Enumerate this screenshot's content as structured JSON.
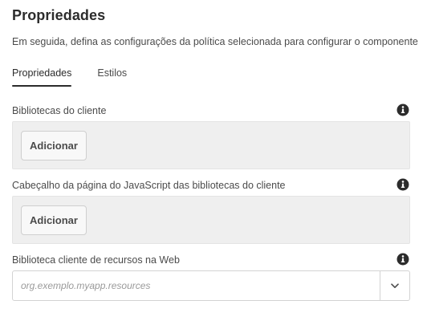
{
  "header": {
    "title": "Propriedades",
    "description": "Em seguida, defina as configurações da política selecionada para configurar o componente"
  },
  "tabs": [
    {
      "label": "Propriedades",
      "active": true
    },
    {
      "label": "Estilos",
      "active": false
    }
  ],
  "fields": {
    "client_libraries": {
      "label": "Bibliotecas do cliente",
      "add_label": "Adicionar",
      "icon": "info-icon"
    },
    "js_head_libraries": {
      "label": "Cabeçalho da página do JavaScript das bibliotecas do cliente",
      "add_label": "Adicionar",
      "icon": "info-icon"
    },
    "web_resources_library": {
      "label": "Biblioteca cliente de recursos na Web",
      "placeholder": "org.exemplo.myapp.resources",
      "value": "",
      "icon": "info-icon",
      "toggle_icon": "chevron-down-icon"
    }
  },
  "colors": {
    "text": "#2c2c2c",
    "muted": "#4b4b4b",
    "panel": "#efefef",
    "border": "#d3d3d3"
  }
}
